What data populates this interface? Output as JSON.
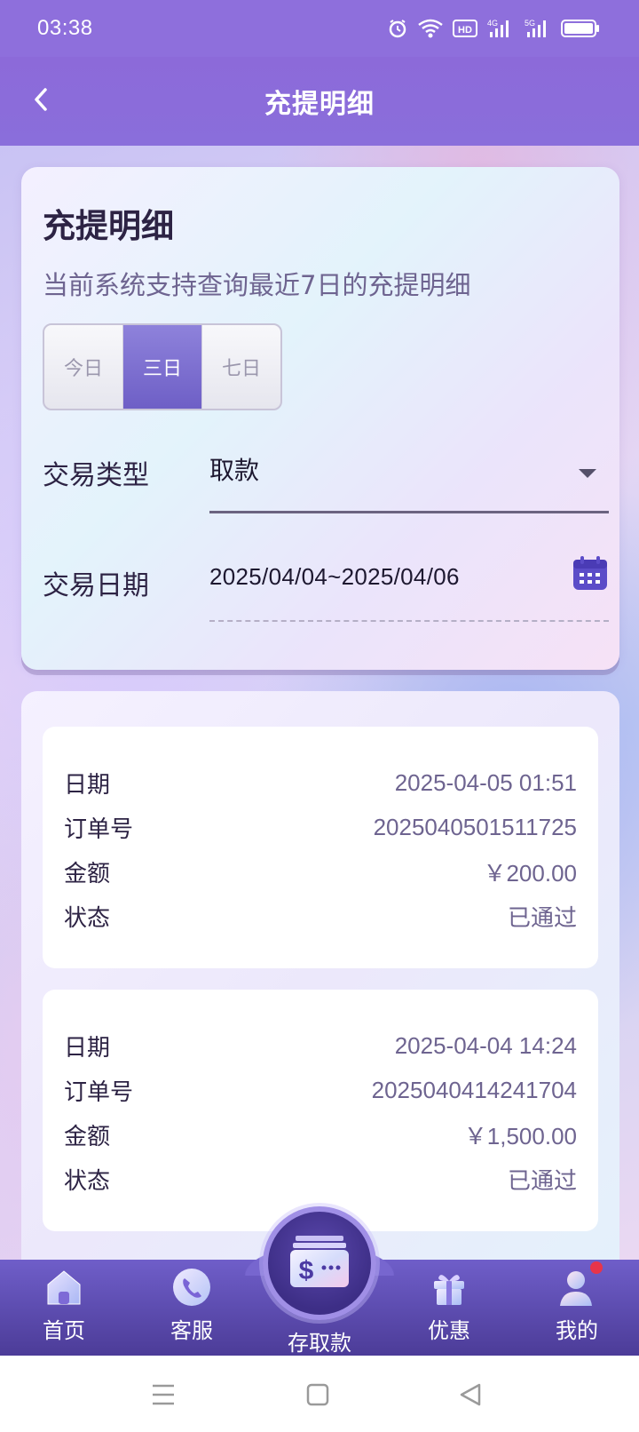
{
  "status_bar": {
    "time": "03:38",
    "icons": [
      "alarm-icon",
      "wifi-icon",
      "hd-icon",
      "signal-4g-icon",
      "signal-5g-icon",
      "battery-icon"
    ],
    "hd_label": "HD",
    "net1": "4G",
    "net2": "5G"
  },
  "header": {
    "title": "充提明细",
    "back_icon": "chevron-left-icon"
  },
  "filter": {
    "title": "充提明细",
    "subtitle": "当前系统支持查询最近7日的充提明细",
    "ranges": [
      "今日",
      "三日",
      "七日"
    ],
    "active_range": "三日",
    "type_label": "交易类型",
    "type_value": "取款",
    "date_label": "交易日期",
    "date_value": "2025/04/04~2025/04/06"
  },
  "records": [
    {
      "date_label": "日期",
      "date": "2025-04-05 01:51",
      "order_label": "订单号",
      "order_no": "2025040501511725",
      "amount_label": "金额",
      "amount": "￥200.00",
      "status_label": "状态",
      "status": "已通过"
    },
    {
      "date_label": "日期",
      "date": "2025-04-04 14:24",
      "order_label": "订单号",
      "order_no": "2025040414241704",
      "amount_label": "金额",
      "amount": "￥1,500.00",
      "status_label": "状态",
      "status": "已通过"
    }
  ],
  "bottom_nav": {
    "items": [
      {
        "label": "首页",
        "icon": "home-icon"
      },
      {
        "label": "客服",
        "icon": "phone-icon"
      },
      {
        "label": "存取款",
        "icon": "wallet-dollar-icon"
      },
      {
        "label": "优惠",
        "icon": "gift-icon"
      },
      {
        "label": "我的",
        "icon": "user-icon"
      }
    ],
    "active": "存取款"
  },
  "colors": {
    "accent": "#8c6ad9",
    "nav": "#5a4aae",
    "badge": "#e8344a"
  }
}
